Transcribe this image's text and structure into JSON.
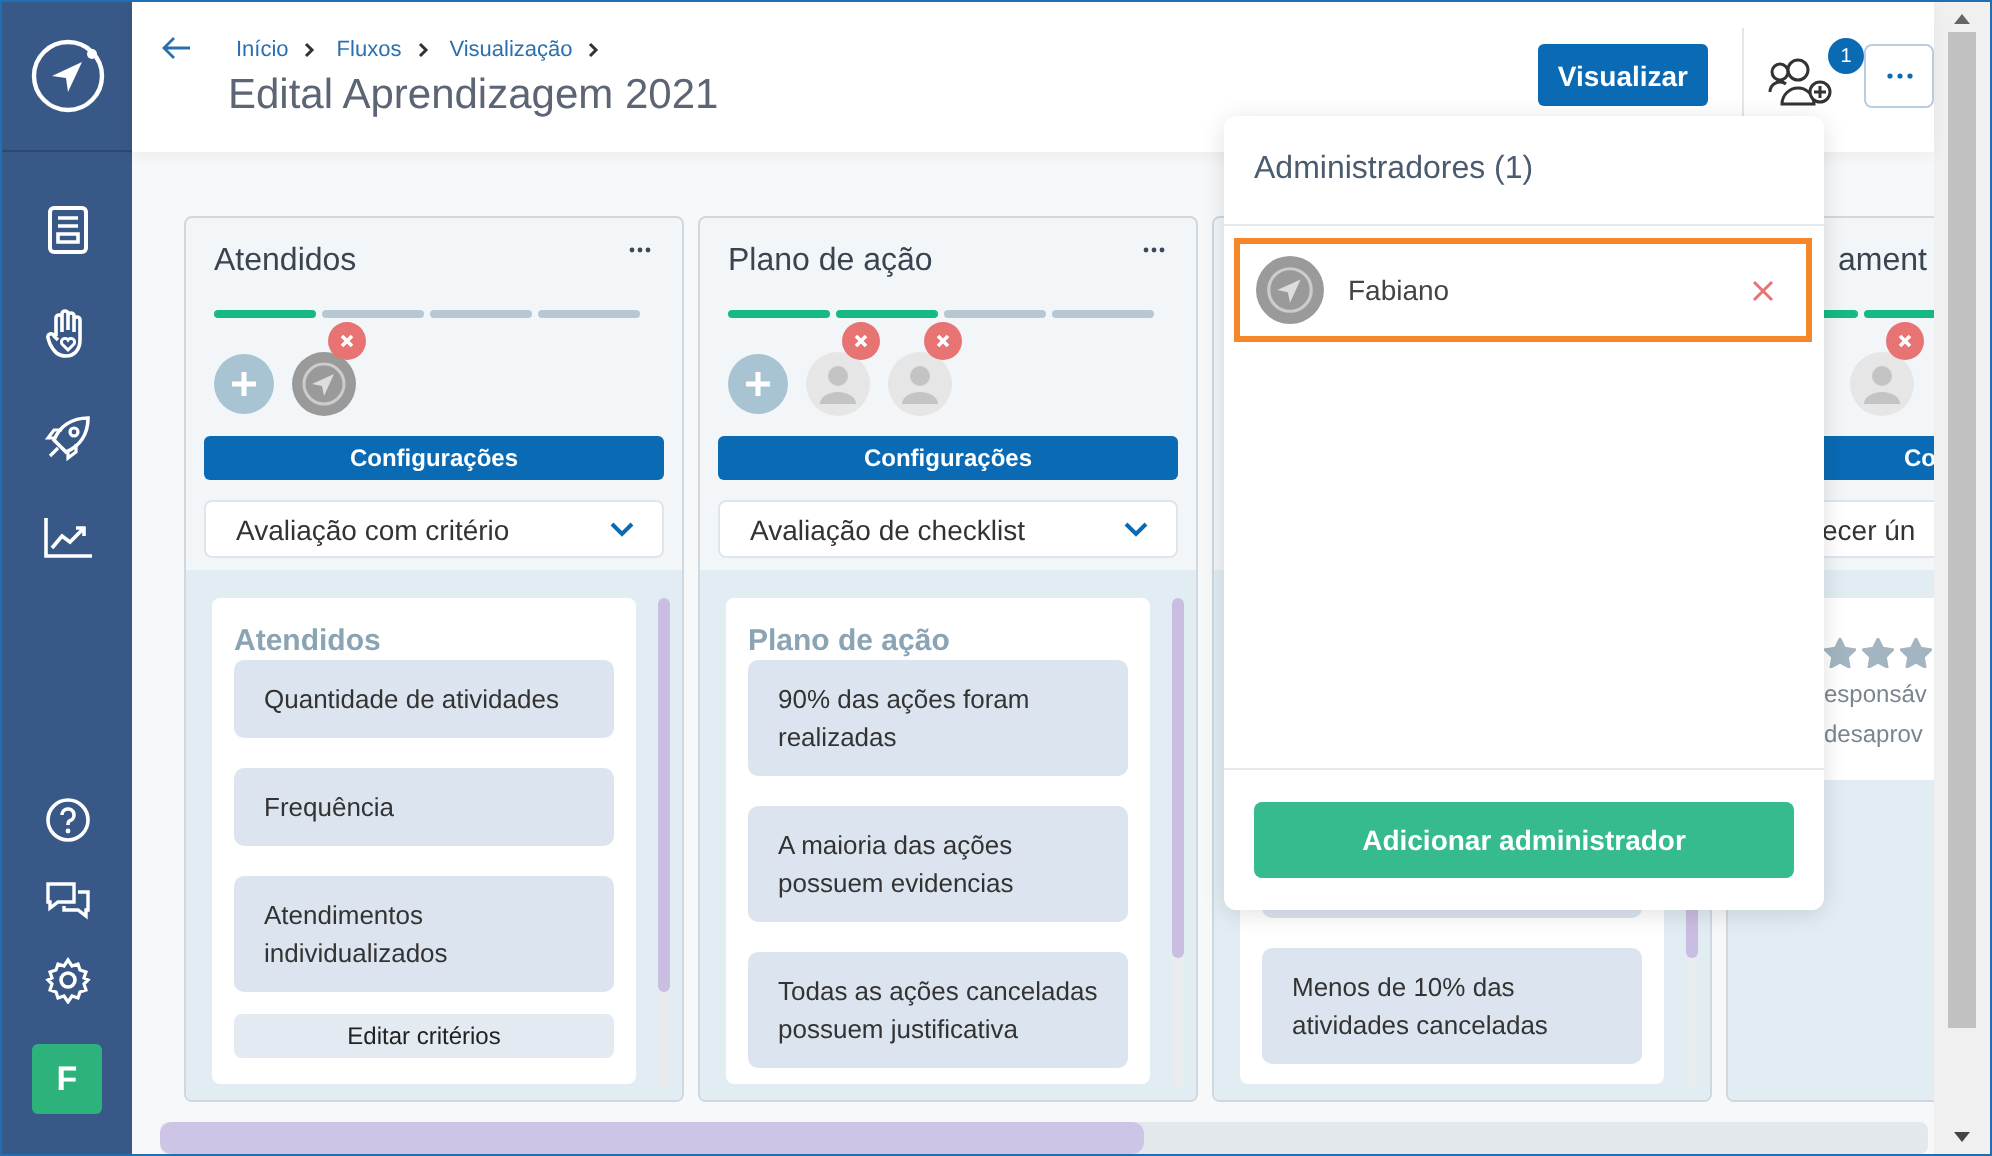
{
  "sidebar": {
    "user_initial": "F"
  },
  "header": {
    "breadcrumbs": [
      "Início",
      "Fluxos",
      "Visualização"
    ],
    "title": "Edital Aprendizagem 2021",
    "primary_button": "Visualizar",
    "admins_badge": "1"
  },
  "columns": [
    {
      "kind": "full",
      "title": "Atendidos",
      "steps": [
        {
          "done": true
        },
        {
          "done": false
        },
        {
          "done": false
        },
        {
          "done": false
        }
      ],
      "avatars": [
        {
          "kind": "add"
        },
        {
          "kind": "logo",
          "removable": true
        }
      ],
      "config_button": "Configurações",
      "dropdown": "Avaliação com critério",
      "panel_title": "Atendidos",
      "cards": [
        {
          "text": "Quantidade de atividades"
        },
        {
          "text": "Frequência"
        },
        {
          "text": "Atendimentos individualizados"
        }
      ],
      "panel_button": "Editar critérios"
    },
    {
      "kind": "full",
      "title": "Plano de ação",
      "steps": [
        {
          "done": true
        },
        {
          "done": true
        },
        {
          "done": false
        },
        {
          "done": false
        }
      ],
      "avatars": [
        {
          "kind": "add"
        },
        {
          "kind": "person",
          "removable": true
        },
        {
          "kind": "person",
          "removable": true
        }
      ],
      "config_button": "Configurações",
      "dropdown": "Avaliação de checklist",
      "panel_title": "Plano de ação",
      "cards": [
        {
          "text": "90% das ações foram realizadas"
        },
        {
          "text": "A maioria das ações possuem evidencias"
        },
        {
          "text": "Todas as ações canceladas possuem justificativa"
        }
      ]
    },
    {
      "kind": "covered",
      "cards": [
        {
          "kind": "blank"
        },
        {
          "kind": "text",
          "text": "Menos de 10% das atividades canceladas"
        }
      ]
    },
    {
      "kind": "partial",
      "title": "ament",
      "steps": [
        {
          "done": true
        },
        {
          "done": true
        }
      ],
      "avatars": [
        {
          "kind": "person",
          "removable": true
        }
      ],
      "config_button": "Co",
      "dropdown": "ecer ún",
      "stars": 3,
      "lines": [
        "esponsáv",
        "desaprov"
      ]
    }
  ],
  "admins_popover": {
    "title": "Administradores (1)",
    "admins": [
      {
        "name": "Fabiano",
        "highlighted": true
      }
    ],
    "add_button": "Adicionar administrador"
  }
}
